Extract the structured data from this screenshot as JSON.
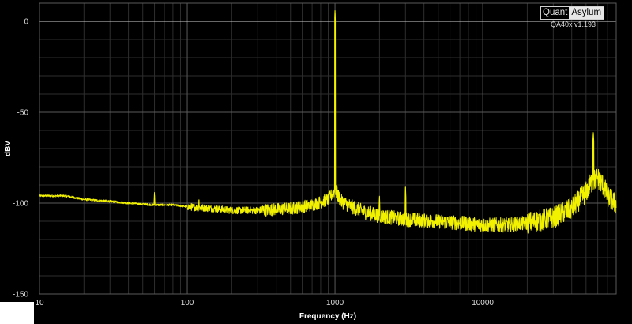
{
  "watermark": {
    "brand_part1": "Quant",
    "brand_part2": "Asylum",
    "version": "QA40x v1.193"
  },
  "colors": {
    "trace": "#f2f200",
    "grid_major": "#5a5a5a",
    "grid_minor": "#2e2e2e",
    "zero_line": "#d0d0d0",
    "background": "#000000"
  },
  "chart_data": {
    "type": "line",
    "title": "",
    "xlabel": "Frequency (Hz)",
    "ylabel": "dBV",
    "xscale": "log",
    "xlim": [
      10,
      80000
    ],
    "ylim": [
      -150,
      10
    ],
    "grid": true,
    "legend": "none",
    "x_ticks": [
      10,
      100,
      1000,
      10000
    ],
    "x_tick_labels": [
      "10",
      "100",
      "1000",
      "10000"
    ],
    "y_ticks": [
      0,
      -50,
      -100,
      -150
    ],
    "y_tick_labels": [
      "0",
      "-50",
      "-100",
      "-150"
    ],
    "series": [
      {
        "color": "#f2f200",
        "noise_floor": {
          "x": [
            10,
            15,
            20,
            30,
            40,
            60,
            80,
            100,
            150,
            200,
            300,
            500,
            700,
            900,
            1000,
            1100,
            1300,
            1600,
            2000,
            3000,
            5000,
            7000,
            10000,
            15000,
            20000,
            30000,
            40000,
            50000,
            55000,
            60000,
            65000,
            70000,
            80000
          ],
          "y": [
            -96,
            -96,
            -98,
            -99,
            -100,
            -101,
            -101,
            -102,
            -103,
            -104,
            -104,
            -103,
            -101,
            -98,
            -93,
            -99,
            -102,
            -105,
            -107,
            -109,
            -110,
            -111,
            -112,
            -112,
            -111,
            -108,
            -103,
            -94,
            -88,
            -86,
            -90,
            -96,
            -101
          ]
        },
        "peaks": [
          {
            "x": 1000,
            "y": 6
          },
          {
            "x": 2000,
            "y": -96
          },
          {
            "x": 3000,
            "y": -91
          },
          {
            "x": 60,
            "y": -94
          },
          {
            "x": 120,
            "y": -98
          },
          {
            "x": 56000,
            "y": -61
          }
        ]
      }
    ]
  }
}
